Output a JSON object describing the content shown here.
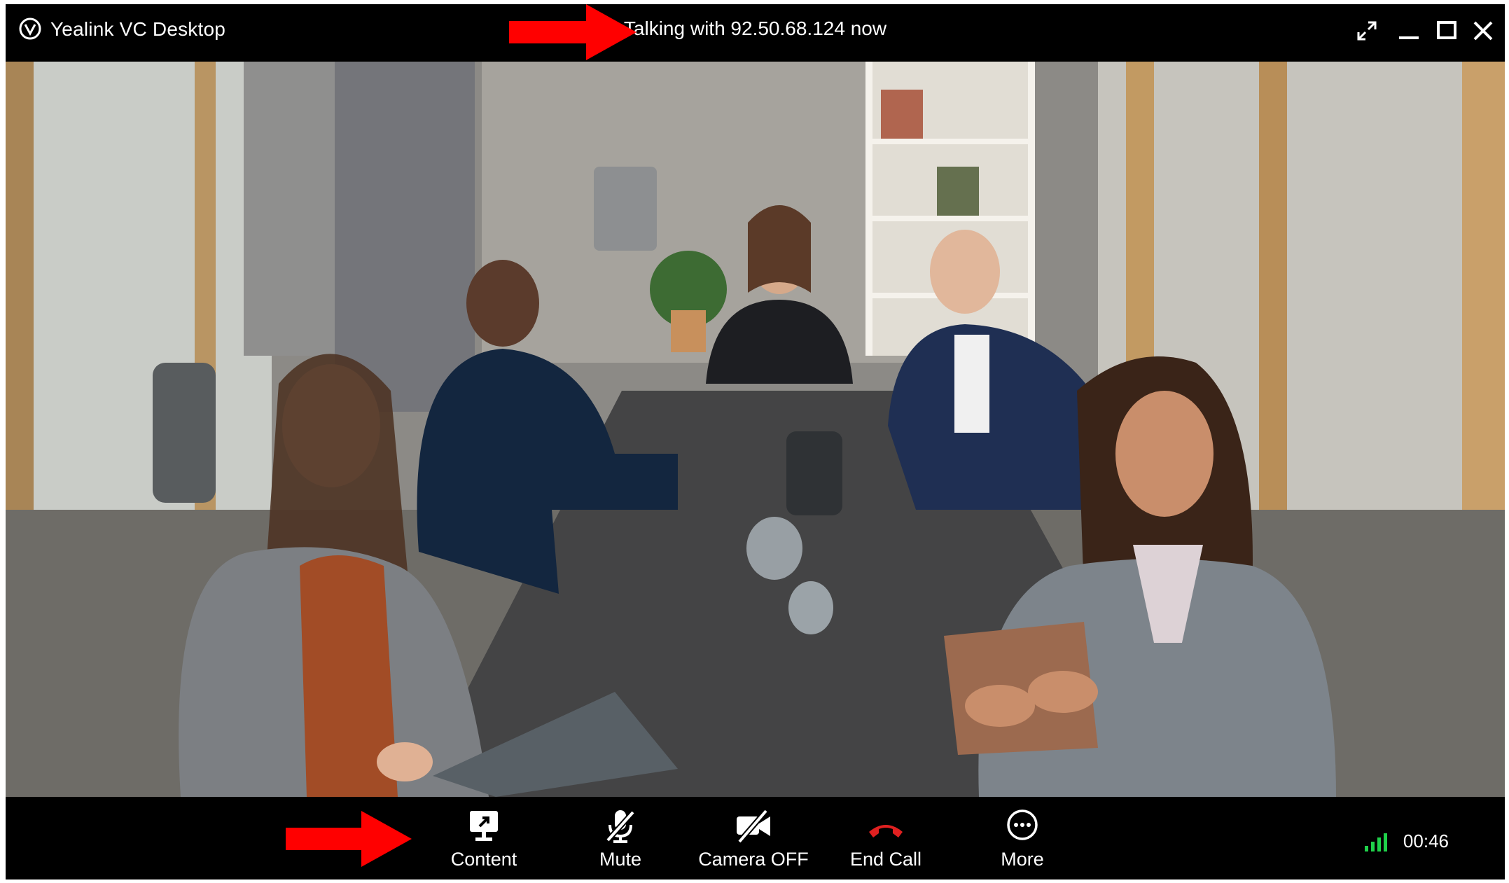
{
  "window": {
    "app_title": "Yealink VC Desktop",
    "call_status": "Talking with 92.50.68.124 now",
    "controls": [
      "fullscreen-icon",
      "minimize-icon",
      "maximize-icon",
      "close-icon"
    ]
  },
  "video": {
    "description_icon": "remote-video-feed"
  },
  "toolbar": {
    "items": [
      {
        "label": "Content",
        "icon": "share-screen-icon"
      },
      {
        "label": "Mute",
        "icon": "mic-muted-icon"
      },
      {
        "label": "Camera OFF",
        "icon": "camera-off-icon"
      },
      {
        "label": "End Call",
        "icon": "hangup-icon",
        "color": "#e02020"
      },
      {
        "label": "More",
        "icon": "more-icon"
      }
    ],
    "signal_color": "#1fd14a",
    "duration": "00:46"
  },
  "annotations": {
    "arrow_color": "#ff0000"
  }
}
